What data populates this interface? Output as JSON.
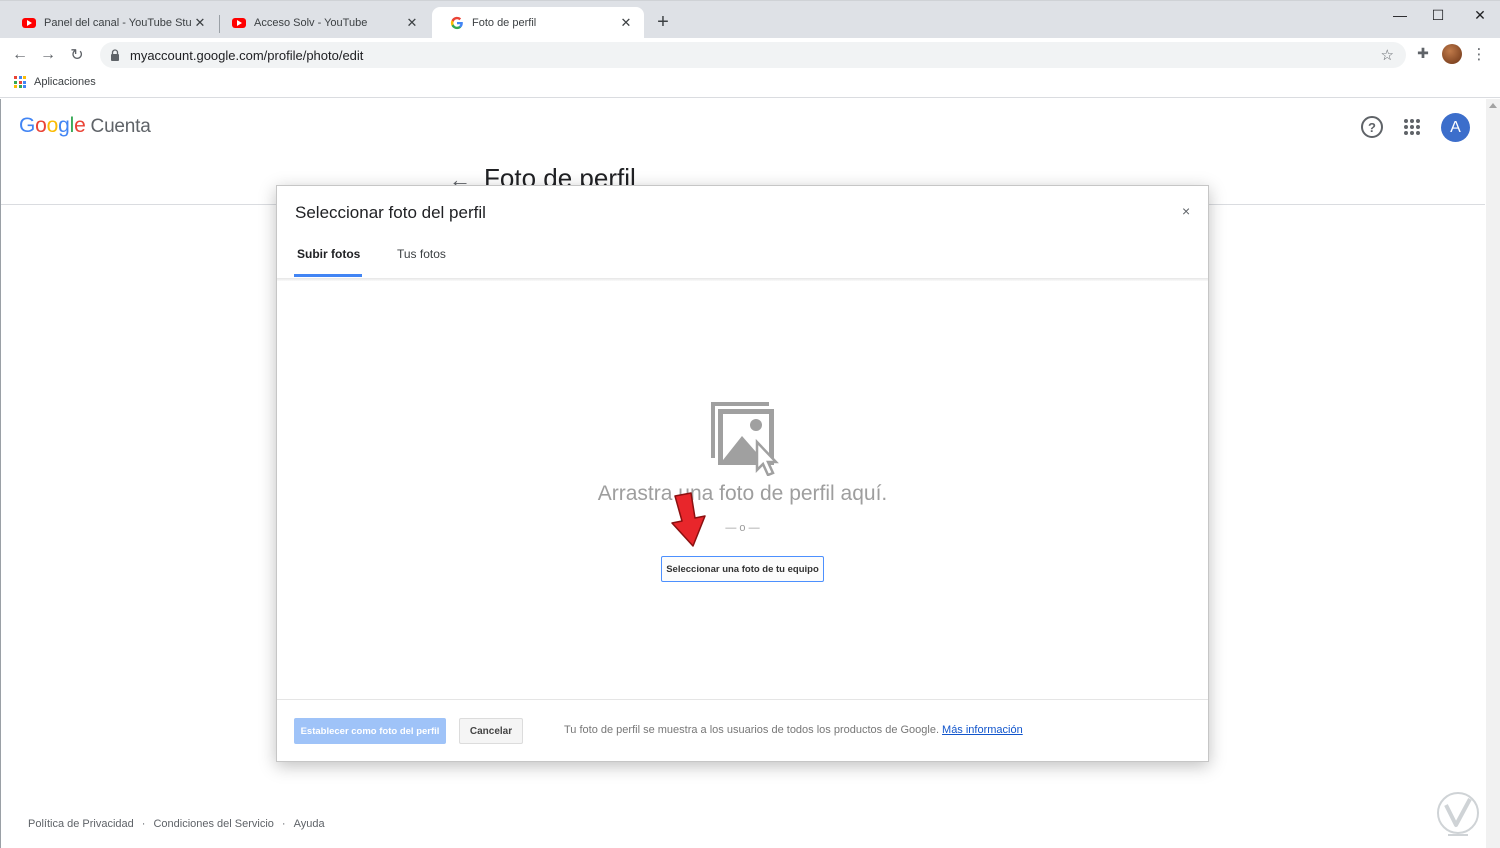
{
  "browser": {
    "tabs": [
      {
        "title": "Panel del canal - YouTube Studio",
        "icon": "youtube-icon",
        "active": false
      },
      {
        "title": "Acceso Solv - YouTube",
        "icon": "youtube-icon",
        "active": false
      },
      {
        "title": "Foto de perfil",
        "icon": "google-g-icon",
        "active": true
      }
    ],
    "new_tab_symbol": "+",
    "window_controls": {
      "minimize": "—",
      "maximize": "☐",
      "close": "✕"
    },
    "url": "myaccount.google.com/profile/photo/edit",
    "bookmarks": {
      "apps_label": "Aplicaciones"
    }
  },
  "header": {
    "logo_brand": "Google",
    "logo_product": "Cuenta",
    "avatar_letter": "A",
    "help_symbol": "?"
  },
  "page": {
    "title": "Foto de perfil"
  },
  "dialog": {
    "title": "Seleccionar foto del perfil",
    "close_symbol": "×",
    "tabs": [
      {
        "label": "Subir fotos",
        "active": true
      },
      {
        "label": "Tus fotos",
        "active": false
      }
    ],
    "drop_text": "Arrastra una foto de perfil aquí.",
    "or_text": "— o —",
    "select_button": "Seleccionar una foto de tu equipo",
    "set_button": "Establecer como foto del perfil",
    "cancel_button": "Cancelar",
    "info_text": "Tu foto de perfil se muestra a los usuarios de todos los productos de Google.",
    "info_link": "Más información"
  },
  "footer": {
    "links": [
      "Política de Privacidad",
      "Condiciones del Servicio",
      "Ayuda"
    ],
    "separator": "·"
  },
  "colors": {
    "accent_blue": "#4285f4",
    "avatar_bg": "#3c6ecb",
    "disabled_button": "#9fc3f8",
    "annotation_arrow": "#e8262b"
  }
}
